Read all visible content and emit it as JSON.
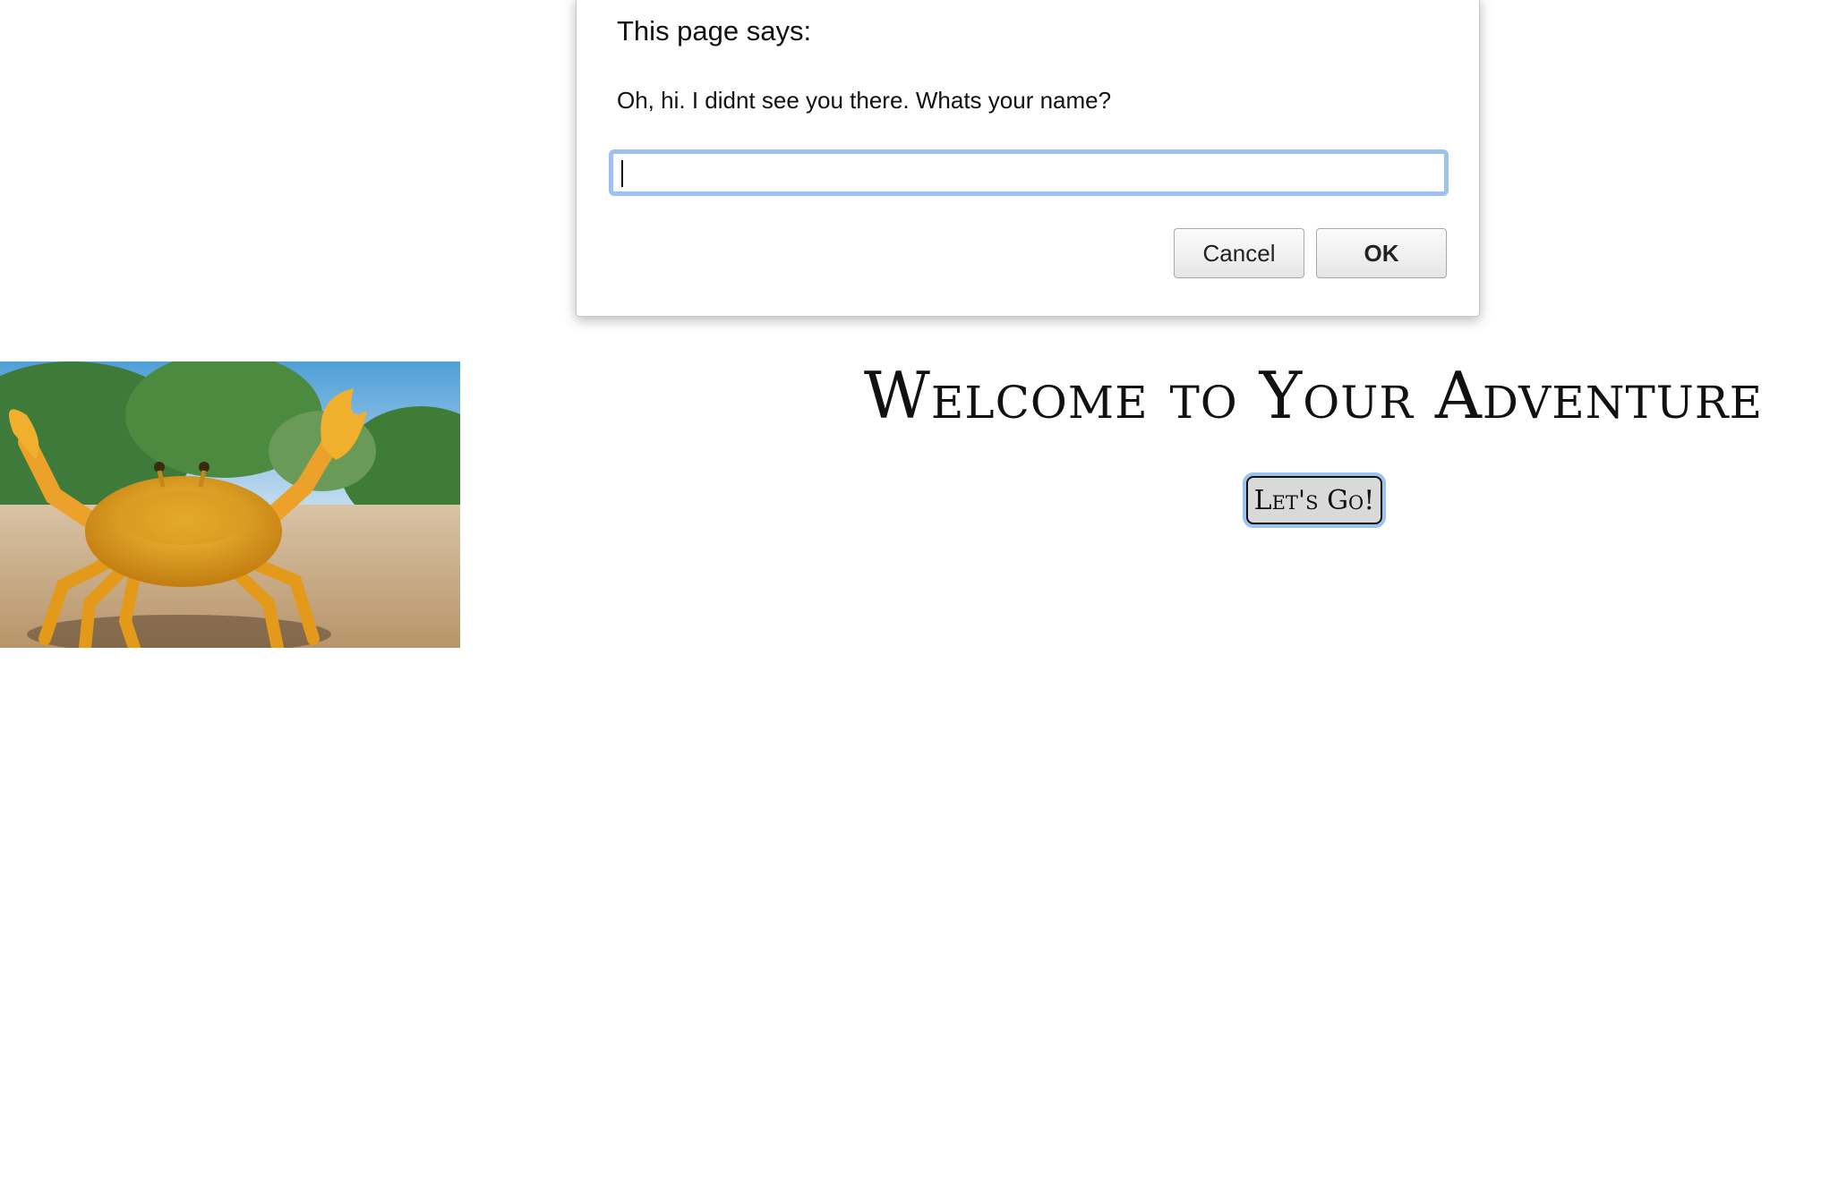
{
  "dialog": {
    "title": "This page says:",
    "message": "Oh, hi. I didnt see you there. Whats your name?",
    "input_value": "",
    "cancel_label": "Cancel",
    "ok_label": "OK"
  },
  "main": {
    "heading": "Welcome to Your Adventure",
    "go_button_label": "Let's Go!"
  },
  "colors": {
    "focus_ring": "#9cc3ef",
    "crab": "#e8a21c"
  }
}
